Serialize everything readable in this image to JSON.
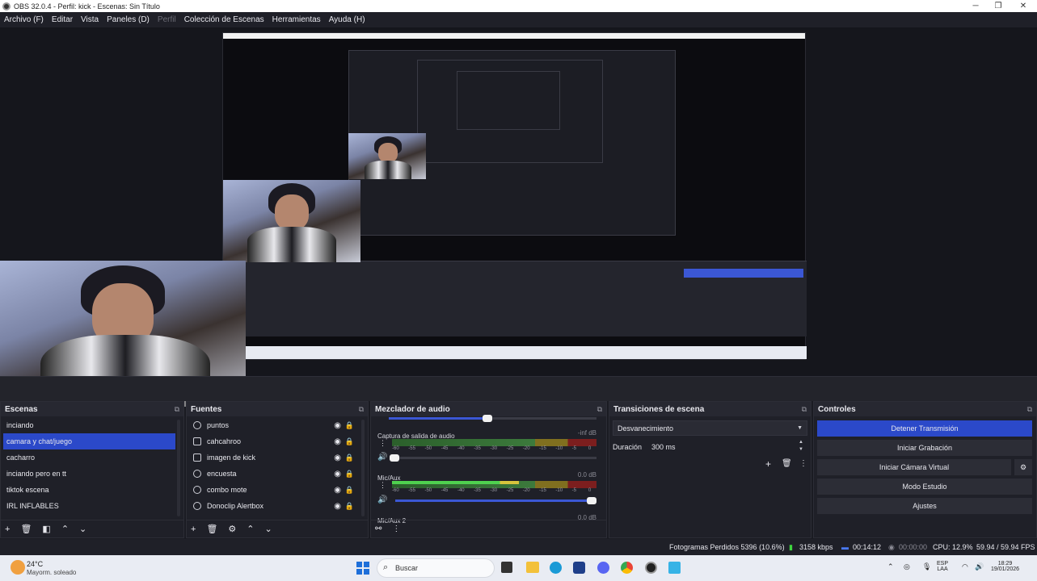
{
  "window": {
    "title": "OBS 32.0.4 - Perfil: kick - Escenas: Sin Título",
    "controls": {
      "minimize": "─",
      "maximize": "❐",
      "close": "✕"
    }
  },
  "menu": [
    {
      "label": "Archivo (F)",
      "enabled": true
    },
    {
      "label": "Editar",
      "enabled": true
    },
    {
      "label": "Vista",
      "enabled": true
    },
    {
      "label": "Paneles (D)",
      "enabled": true
    },
    {
      "label": "Perfil",
      "enabled": false
    },
    {
      "label": "Colección de Escenas",
      "enabled": true
    },
    {
      "label": "Herramientas",
      "enabled": true
    },
    {
      "label": "Ayuda (H)",
      "enabled": true
    }
  ],
  "scenes": {
    "title": "Escenas",
    "items": [
      "inciando",
      "camara y chat/juego",
      "cacharro",
      "inciando pero en tt",
      "tiktok escena",
      "IRL INFLABLES"
    ],
    "selected_index": 1,
    "footer_icons": [
      "plus-icon",
      "trash-icon",
      "filter-icon",
      "arrow-up-icon",
      "arrow-down-icon"
    ]
  },
  "sources": {
    "title": "Fuentes",
    "items": [
      {
        "label": "puntos",
        "icon": "globe-icon"
      },
      {
        "label": "cahcahroo",
        "icon": "camera-icon"
      },
      {
        "label": "imagen de kick",
        "icon": "image-icon"
      },
      {
        "label": "encuesta",
        "icon": "globe-icon"
      },
      {
        "label": "combo mote",
        "icon": "globe-icon"
      },
      {
        "label": "Donoclip Alertbox",
        "icon": "globe-icon"
      }
    ]
  },
  "mixer": {
    "title": "Mezclador de audio",
    "tracks": [
      {
        "name": "Captura de salida de audio",
        "db": "-inf dB",
        "level": 0.0,
        "volume": 0.02
      },
      {
        "name": "Mic/Aux",
        "db": "0.0 dB",
        "level": 0.62,
        "volume": 1.0
      },
      {
        "name": "Mic/Aux 2",
        "db": "0.0 dB"
      }
    ],
    "scale": [
      "-60",
      "-55",
      "-50",
      "-45",
      "-40",
      "-35",
      "-30",
      "-25",
      "-20",
      "-15",
      "-10",
      "-5",
      "0"
    ]
  },
  "transitions": {
    "title": "Transiciones de escena",
    "selected": "Desvanecimiento",
    "duration_label": "Duración",
    "duration_value": "300 ms"
  },
  "controls": {
    "title": "Controles",
    "buttons": [
      "Detener Transmisión",
      "Iniciar Grabación",
      "Iniciar Cámara Virtual",
      "Modo Estudio",
      "Ajustes"
    ]
  },
  "status": {
    "dropped_frames": "Fotogramas Perdidos 5396 (10.6%)",
    "bitrate": "3158 kbps",
    "stream_time": "00:14:12",
    "record_time": "00:00:00",
    "cpu": "CPU: 12.9%",
    "fps": "59.94 / 59.94 FPS"
  },
  "taskbar": {
    "weather_temp": "24°C",
    "weather_desc": "Mayorm. soleado",
    "search_placeholder": "Buscar",
    "lang_line1": "ESP",
    "lang_line2": "LAA",
    "time": "18:29",
    "date": "19/01/2026"
  },
  "colors": {
    "accent": "#2b49c9",
    "panel": "#1f2028",
    "background": "#1a1b22"
  }
}
